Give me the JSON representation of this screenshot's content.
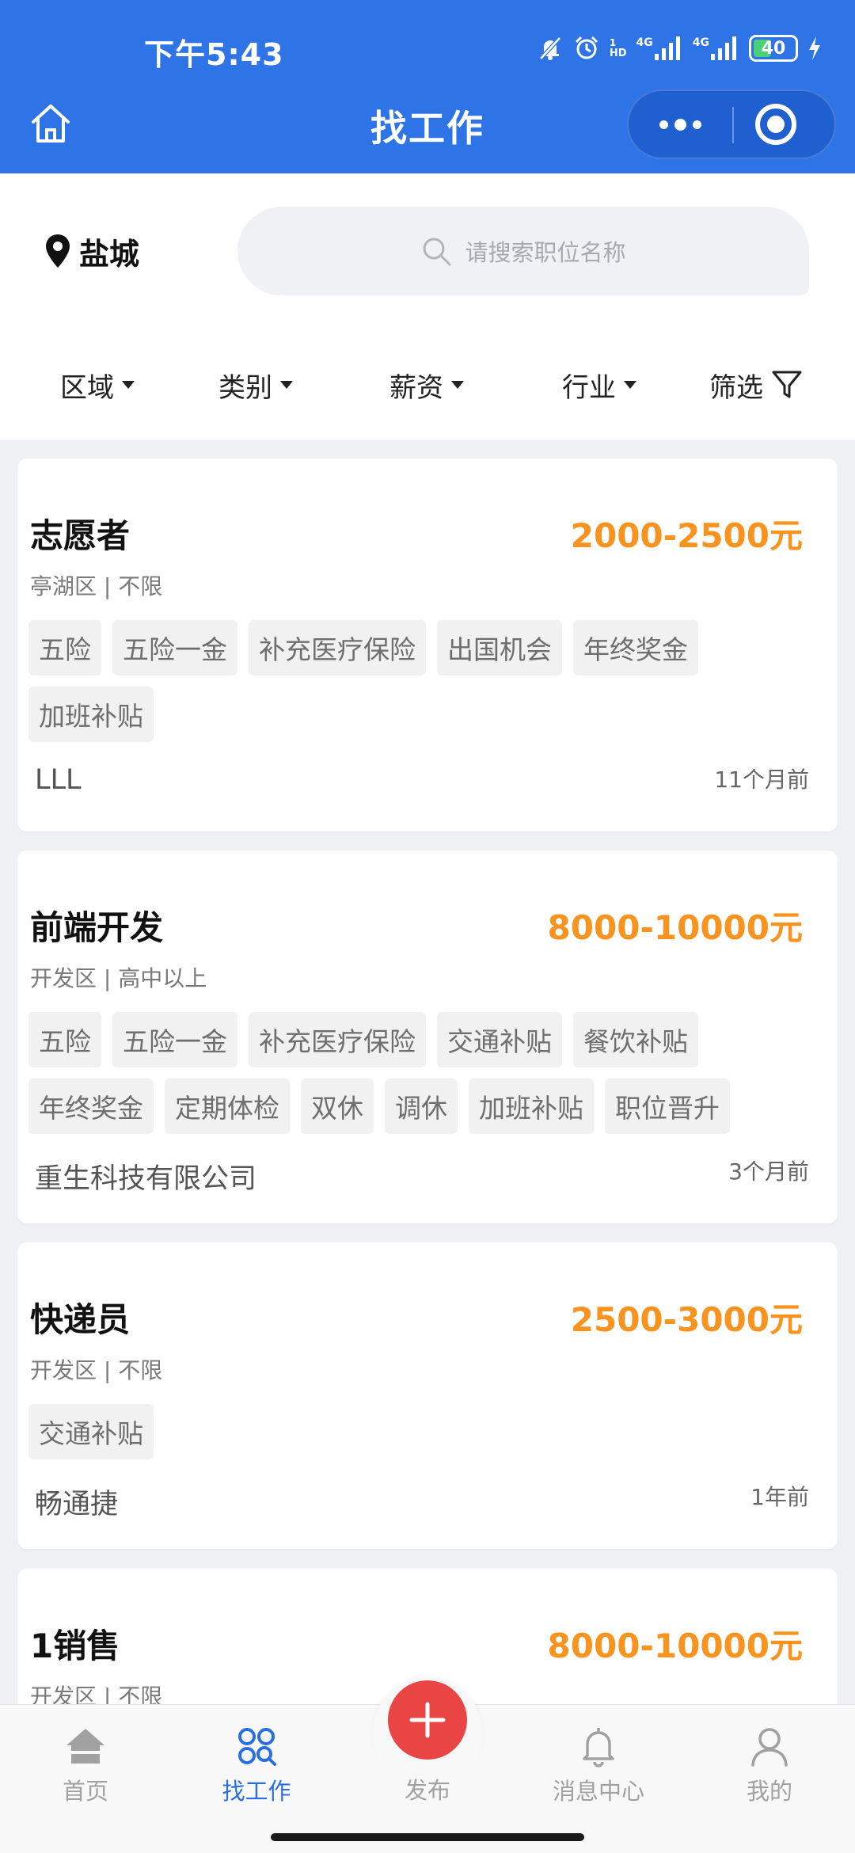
{
  "status_bar": {
    "time": "下午5:43",
    "network_label_1": "4G",
    "network_label_2": "4G",
    "hd_label": "HD",
    "battery": "40"
  },
  "nav": {
    "title": "找工作"
  },
  "location": {
    "city": "盐城"
  },
  "search": {
    "placeholder": "请搜索职位名称"
  },
  "filters": [
    "区域",
    "类别",
    "薪资",
    "行业",
    "筛选"
  ],
  "jobs": [
    {
      "title": "志愿者",
      "salary": "2000-2500元",
      "meta": "亭湖区 | 不限",
      "tags": [
        "五险",
        "五险一金",
        "补充医疗保险",
        "出国机会",
        "年终奖金",
        "加班补贴"
      ],
      "company": "LLL",
      "posted": "11个月前"
    },
    {
      "title": "前端开发",
      "salary": "8000-10000元",
      "meta": "开发区 | 高中以上",
      "tags": [
        "五险",
        "五险一金",
        "补充医疗保险",
        "交通补贴",
        "餐饮补贴",
        "年终奖金",
        "定期体检",
        "双休",
        "调休",
        "加班补贴",
        "职位晋升"
      ],
      "company": "重生科技有限公司",
      "posted": "3个月前"
    },
    {
      "title": "快递员",
      "salary": "2500-3000元",
      "meta": "开发区 | 不限",
      "tags": [
        "交通补贴"
      ],
      "company": "畅通捷",
      "posted": "1年前"
    },
    {
      "title": "1销售",
      "salary": "8000-10000元",
      "meta": "开发区 | 不限",
      "tags": [],
      "company": "",
      "posted": ""
    }
  ],
  "tabbar": {
    "home": "首页",
    "jobs": "找工作",
    "publish": "发布",
    "messages": "消息中心",
    "mine": "我的"
  },
  "colors": {
    "brand_blue": "#2f74e6",
    "salary_orange": "#f7931e",
    "publish_red": "#e94545",
    "tab_active": "#2a6fe0"
  }
}
